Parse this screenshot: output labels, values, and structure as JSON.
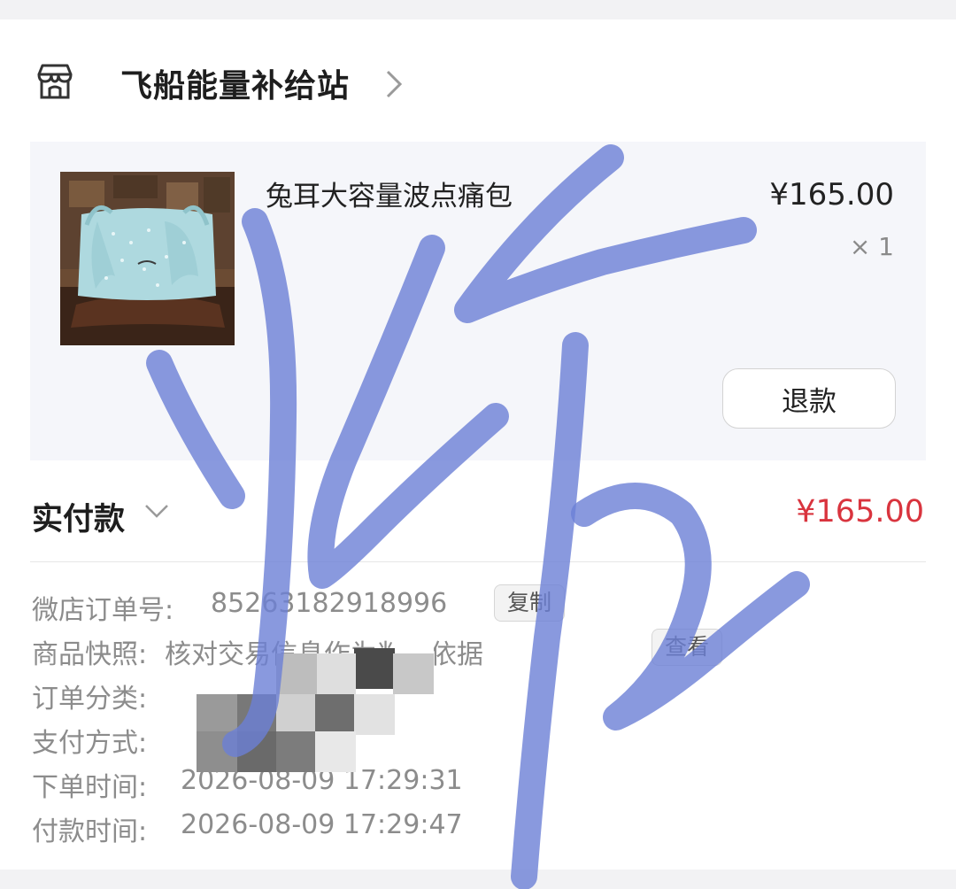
{
  "shop": {
    "icon": "store-icon",
    "name": "飞船能量补给站",
    "chevron_icon": "chevron-right-icon"
  },
  "item": {
    "image_icon": "product-thumbnail",
    "title": "兔耳大容量波点痛包",
    "price": "¥165.00",
    "quantity": "× 1",
    "refund_label": "退款"
  },
  "payment": {
    "label": "实付款",
    "chevron_icon": "chevron-down-icon",
    "amount": "¥165.00",
    "amount_color": "#d9343e"
  },
  "order_info": {
    "order_no_label": "微店订单号:",
    "order_no_value": "85263182918996",
    "copy_label": "复制",
    "snapshot_label": "商品快照:",
    "snapshot_value": "核对交易信息作为判断依据",
    "view_label": "查看",
    "category_label": "订单分类:",
    "category_value": "",
    "pay_method_label": "支付方式:",
    "pay_method_value": "",
    "order_time_label": "下单时间:",
    "order_time_value": "2026-08-09 17:29:31",
    "pay_time_label": "付款时间:",
    "pay_time_value": "2026-08-09 17:29:47"
  },
  "overlay": {
    "scribble_color": "#6b7fd6"
  }
}
